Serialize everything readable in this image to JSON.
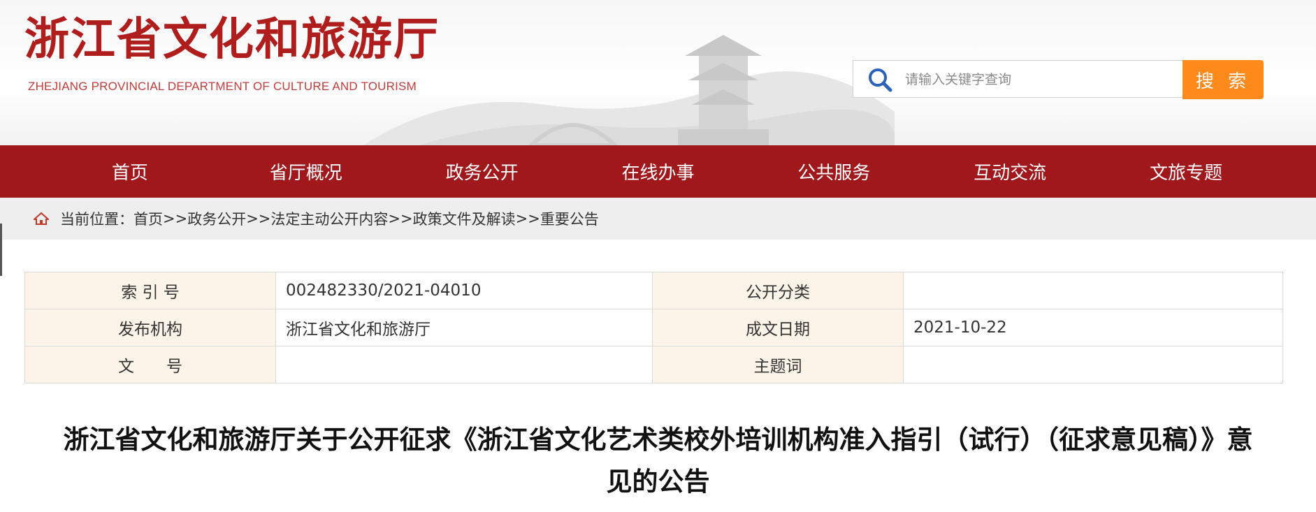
{
  "header": {
    "title": "浙江省文化和旅游厅",
    "subtitle": "ZHEJIANG PROVINCIAL DEPARTMENT OF CULTURE AND TOURISM"
  },
  "search": {
    "placeholder": "请输入关键字查询",
    "button_label": "搜 索"
  },
  "colors": {
    "brand_red": "#a0171c",
    "search_orange": "#ff8a1c",
    "label_bg": "#fdf4e9"
  },
  "nav": {
    "items": [
      {
        "label": "首页"
      },
      {
        "label": "省厅概况"
      },
      {
        "label": "政务公开"
      },
      {
        "label": "在线办事"
      },
      {
        "label": "公共服务"
      },
      {
        "label": "互动交流"
      },
      {
        "label": "文旅专题"
      }
    ]
  },
  "breadcrumb": {
    "prefix": "当前位置：",
    "path": [
      {
        "label": "首页"
      },
      {
        "label": "政务公开"
      },
      {
        "label": "法定主动公开内容"
      },
      {
        "label": "政策文件及解读"
      },
      {
        "label": "重要公告"
      }
    ],
    "separator": ">>"
  },
  "meta": {
    "index_label": "索 引 号",
    "index_value": "002482330/2021-04010",
    "category_label": "公开分类",
    "category_value": "",
    "publisher_label": "发布机构",
    "publisher_value": "浙江省文化和旅游厅",
    "date_label": "成文日期",
    "date_value": "2021-10-22",
    "docno_label": "文　　号",
    "docno_value": "",
    "topic_label": "主题词",
    "topic_value": ""
  },
  "document": {
    "title": "浙江省文化和旅游厅关于公开征求《浙江省文化艺术类校外培训机构准入指引（试行）（征求意见稿）》意见的公告"
  }
}
